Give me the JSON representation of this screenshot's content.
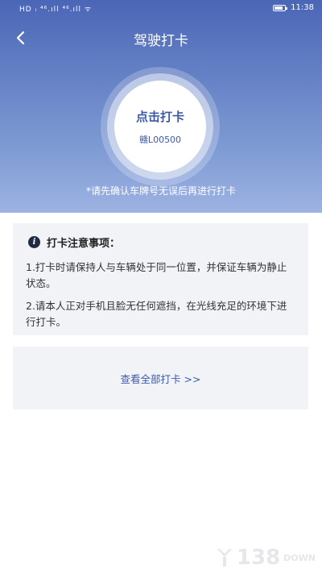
{
  "status_bar": {
    "left_text": "HD ᵢ ⁴⁶.ıll ⁴⁶.ıll ᯤ",
    "time": "11:38",
    "battery_level": 0.8
  },
  "header": {
    "back_icon": "chevron-left-icon",
    "title": "驾驶打卡"
  },
  "punch": {
    "label": "点击打卡",
    "plate": "赣L00500"
  },
  "tip": "*请先确认车牌号无误后再进行打卡",
  "notice": {
    "icon": "info-icon",
    "title": "打卡注意事项：",
    "items": [
      "1.打卡时请保持人与车辆处于同一位置，并保证车辆为静止状态。",
      "2.请本人正对手机且脸无任何遮挡，在光线充足的环境下进行打卡。"
    ]
  },
  "view_all": {
    "label": "查看全部打卡 >>"
  },
  "watermark": {
    "text": "138",
    "suffix": "DOWN"
  },
  "colors": {
    "hero_top": "#4a66b6",
    "hero_bottom": "#9db3e2",
    "accent": "#3e5aa6",
    "card_bg": "#f2f3f6"
  }
}
